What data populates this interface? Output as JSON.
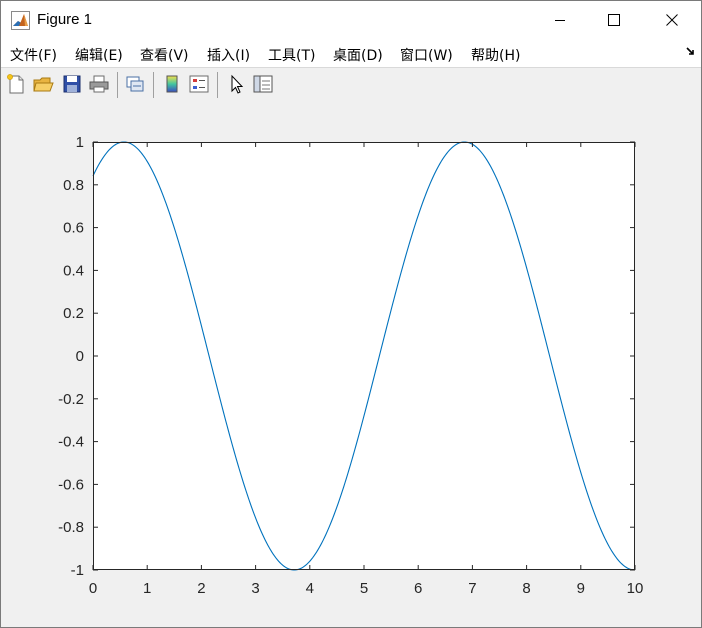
{
  "window": {
    "title": "Figure 1",
    "icon": "matlab-logo-icon",
    "controls": [
      "minimize-icon",
      "maximize-icon",
      "close-icon"
    ]
  },
  "menu": {
    "items": [
      {
        "label": "文件(F)"
      },
      {
        "label": "编辑(E)"
      },
      {
        "label": "查看(V)"
      },
      {
        "label": "插入(I)"
      },
      {
        "label": "工具(T)"
      },
      {
        "label": "桌面(D)"
      },
      {
        "label": "窗口(W)"
      },
      {
        "label": "帮助(H)"
      }
    ]
  },
  "toolbar": {
    "buttons": [
      "new-figure-icon",
      "open-file-icon",
      "save-icon",
      "print-icon",
      "link-plot-icon",
      "insert-colorbar-icon",
      "insert-legend-icon",
      "edit-plot-arrow-icon",
      "property-editor-icon"
    ]
  },
  "chart_data": {
    "type": "line",
    "function_samples": "y = sin(x + 1)",
    "x": [
      0,
      0.5,
      1,
      1.5,
      2,
      2.5,
      3,
      3.5,
      4,
      4.5,
      5,
      5.5,
      6,
      6.5,
      7,
      7.5,
      8,
      8.5,
      9,
      9.5,
      10
    ],
    "series": [
      {
        "values": [
          0.841,
          0.997,
          0.909,
          0.598,
          0.141,
          -0.351,
          -0.757,
          -0.977,
          -0.959,
          -0.706,
          -0.279,
          0.215,
          0.657,
          0.938,
          0.989,
          0.798,
          0.412,
          -0.075,
          -0.544,
          -0.88,
          -1.0
        ],
        "color": "#0072bd"
      }
    ],
    "xlim": [
      0,
      10
    ],
    "ylim": [
      -1,
      1
    ],
    "xticks": [
      "0",
      "1",
      "2",
      "3",
      "4",
      "5",
      "6",
      "7",
      "8",
      "9",
      "10"
    ],
    "yticks": [
      "1",
      "0.8",
      "0.6",
      "0.4",
      "0.2",
      "0",
      "-0.2",
      "-0.4",
      "-0.6",
      "-0.8",
      "-1"
    ],
    "grid": false,
    "title": "",
    "xlabel": "",
    "ylabel": ""
  }
}
